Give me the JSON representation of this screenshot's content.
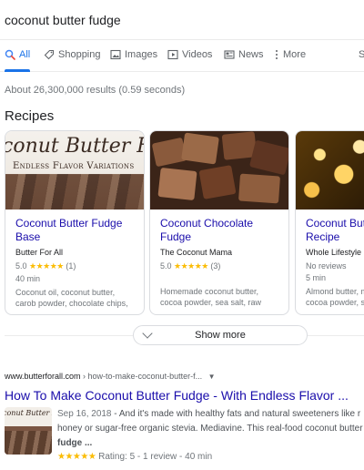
{
  "search": {
    "query": "coconut butter fudge"
  },
  "tabs": [
    {
      "label": "All",
      "icon": "search-icon"
    },
    {
      "label": "Shopping",
      "icon": "tag-icon"
    },
    {
      "label": "Images",
      "icon": "image-icon"
    },
    {
      "label": "Videos",
      "icon": "play-icon"
    },
    {
      "label": "News",
      "icon": "news-icon"
    },
    {
      "label": "More",
      "icon": "kebab-icon"
    },
    {
      "label": "S"
    }
  ],
  "stats": "About 26,300,000 results (0.59 seconds)",
  "recipes": {
    "title": "Recipes",
    "cards": [
      {
        "title_line1": "Coconut Butter Fudge",
        "title_line2": "Base",
        "site": "Butter For All",
        "rating": "5.0",
        "stars": "★★★★★",
        "count": "(1)",
        "time": "40 min",
        "ingredients_line1": "Coconut oil, coconut butter,",
        "ingredients_line2": "carob powder, chocolate chips,",
        "image_text_top": "conut Butter Fud",
        "image_text_bottom": "Endless Flavor Variations"
      },
      {
        "title_line1": "Coconut Chocolate",
        "title_line2": "Fudge",
        "site": "The Coconut Mama",
        "rating": "5.0",
        "stars": "★★★★★",
        "count": "(3)",
        "time": "",
        "ingredients_line1": "Homemade coconut butter,",
        "ingredients_line2": "cocoa powder, sea salt, raw"
      },
      {
        "title_line1": "Coconut But",
        "title_line2": "Recipe",
        "site": "Whole Lifestyle N",
        "rating_text": "No reviews",
        "time": "5 min",
        "ingredients_line1": "Almond butter, m",
        "ingredients_line2": "cocoa powder, sh"
      }
    ]
  },
  "show_more": "Show more",
  "result": {
    "url_domain": "www.butterforall.com",
    "url_path": " › how-to-make-coconut-butter-f...",
    "title": "How To Make Coconut Butter Fudge - With Endless Flavor ...",
    "date": "Sep 16, 2018",
    "snippet_line1": " - And it's made with healthy fats and natural sweeteners like r",
    "snippet_line2": "honey or sugar-free organic stevia. Mediavine. This real-food coconut butter",
    "snippet_line3": "fudge ...",
    "stars": "★★★★★",
    "rating_text": "Rating: 5 - 1 review - 40 min",
    "thumb_text": "conut Butter Fudg"
  },
  "colors": {
    "link": "#1a0dab",
    "accent": "#1a73e8",
    "star": "#fbbc04"
  }
}
